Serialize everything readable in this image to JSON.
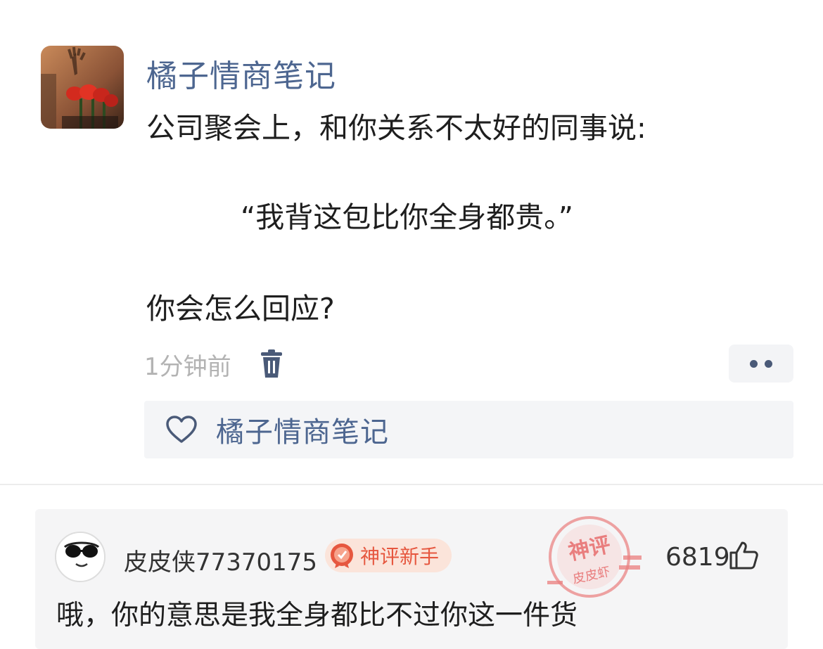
{
  "post": {
    "author": "橘子情商笔记",
    "line1": "公司聚会上，和你关系不太好的同事说:",
    "quote": "“我背这包比你全身都贵。”",
    "question": "你会怎么回应?",
    "time": "1分钟前",
    "liker": "橘子情商笔记"
  },
  "comment": {
    "username": "皮皮侠77370175",
    "badge": "神评新手",
    "stamp_top": "神评",
    "stamp_bottom": "皮皮虾",
    "likes": "6819",
    "text": "哦，你的意思是我全身都比不过你这一件货"
  },
  "icons": [
    "trash-icon",
    "more-icon",
    "heart-icon",
    "thumbs-up-icon",
    "medal-icon"
  ],
  "colors": {
    "author": "#4d6690",
    "badge_text": "#e6573f",
    "badge_bg": "#fbe4da",
    "stamp": "#e86a6a"
  }
}
